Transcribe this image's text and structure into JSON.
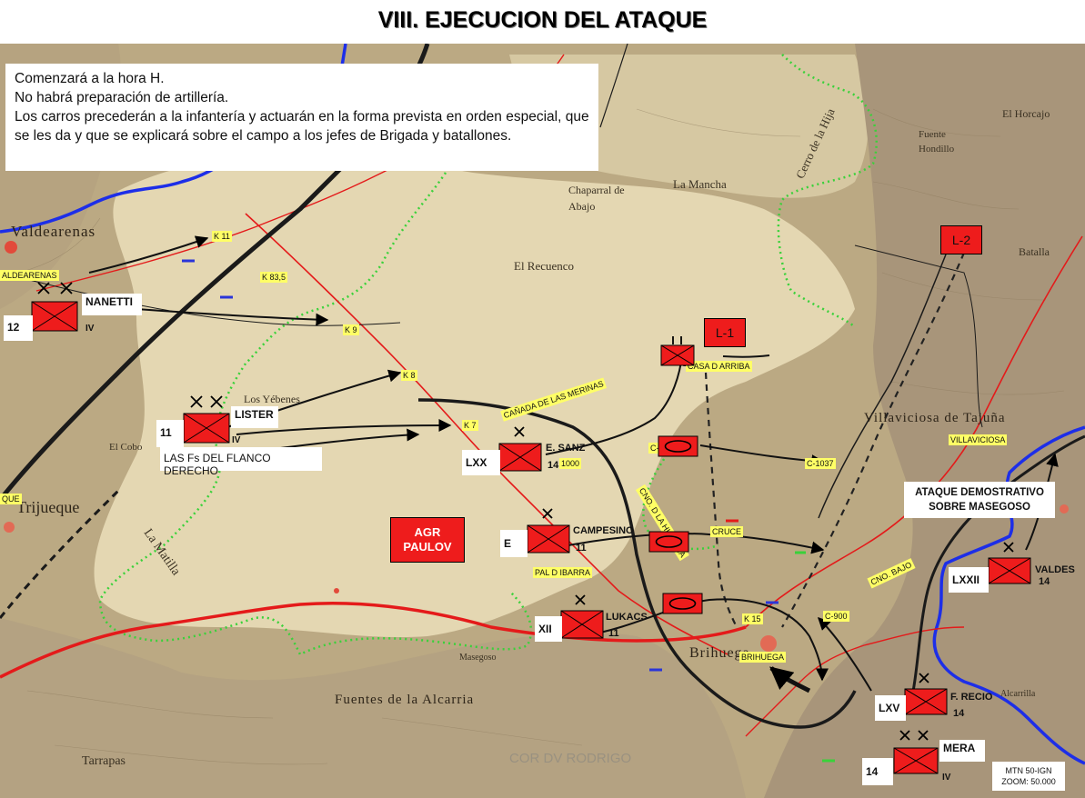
{
  "title": "VIII. EJECUCION DEL ATAQUE",
  "orders": [
    "Comenzará a la hora H.",
    "No habrá preparación de artillería.",
    "Los carros precederán a la infantería y actuarán en la forma prevista en orden especial, que se les da y que se explicará sobre el campo a los jefes de Brigada y batallones."
  ],
  "units": {
    "nanetti": {
      "name": "NANETTI",
      "number": "12",
      "level": "IV"
    },
    "lister": {
      "name": "LISTER",
      "number": "11",
      "level": "IV",
      "note": "LAS Fs DEL FLANCO DERECHO"
    },
    "esanz": {
      "name": "E. SANZ",
      "number": "14",
      "id": "LXX"
    },
    "campesino": {
      "name": "CAMPESINO",
      "number": "11",
      "id": "E"
    },
    "lukacs": {
      "name": "LUKACS",
      "number": "11",
      "id": "XII"
    },
    "valdes": {
      "name": "VALDES",
      "number": "14",
      "id": "LXXII"
    },
    "frecio": {
      "name": "F. RECIO",
      "number": "14",
      "id": "LXV"
    },
    "mera": {
      "name": "MERA",
      "number": "14",
      "level": "IV"
    }
  },
  "objectives": {
    "l1": "L-1",
    "l2": "L-2"
  },
  "agr": {
    "line1": "AGR",
    "line2": "PAULOV"
  },
  "ataque": {
    "line1": "ATAQUE DEMOSTRATIVO",
    "line2": "SOBRE MASEGOSO"
  },
  "yellow_labels": {
    "aldearenas": "ALDEARENAS",
    "k11": "K 11",
    "k835": "K 83,5",
    "k9": "K 9",
    "k8": "K 8",
    "k7": "K 7",
    "merinas": "CAÑADA DE LAS MERINAS",
    "casa": "CASA D ARRIBA",
    "c1": "C-1",
    "n1000": "1000",
    "higuera": "CNO. D LA HIGUERA",
    "c1037": "C-1037",
    "cruce": "CRUCE",
    "ibarra": "PAL D IBARRA",
    "que": "QUE",
    "villaviciosa": "VILLAVICIOSA",
    "cnobajo": "CNO. BAJO",
    "c900": "C-900",
    "k15": "K 15",
    "brihuega": "BRIHUEGA"
  },
  "map_text": {
    "valdearenas": "Valdearenas",
    "yebenes": "Los Yébenes",
    "recuenco": "El Recuenco",
    "matilla": "La Matilla",
    "fuentes": "Fuentes de la Alcarria",
    "brihuega": "Brihuega",
    "villaviciosa": "Villaviciosa de Tajuña",
    "tarrapas": "Tarrapas",
    "mancha": "La Mancha",
    "cerro": "Cerro de la Hija",
    "masegoso": "Masegoso",
    "trijueque": "Trijueque",
    "chaparral": "Chaparral de Abajo",
    "batalla": "Batalla",
    "horcajo": "El Horcajo",
    "fuente": "Fuente Hondillo",
    "alcarrilla": "Alcarrilla",
    "cobo": "El Cobo"
  },
  "watermark": "COR DV RODRIGO",
  "scale": {
    "line1": "MTN 50-IGN",
    "line2": "ZOOM: 50.000"
  },
  "colors": {
    "unit_red": "#ee1c1c",
    "road_red": "#e41a1a",
    "green_line": "#3ad13a",
    "river_blue": "#1d2ee8",
    "paper": "#cdbf9b",
    "tan": "#e8dcb5",
    "label_yellow": "#ffff66"
  }
}
